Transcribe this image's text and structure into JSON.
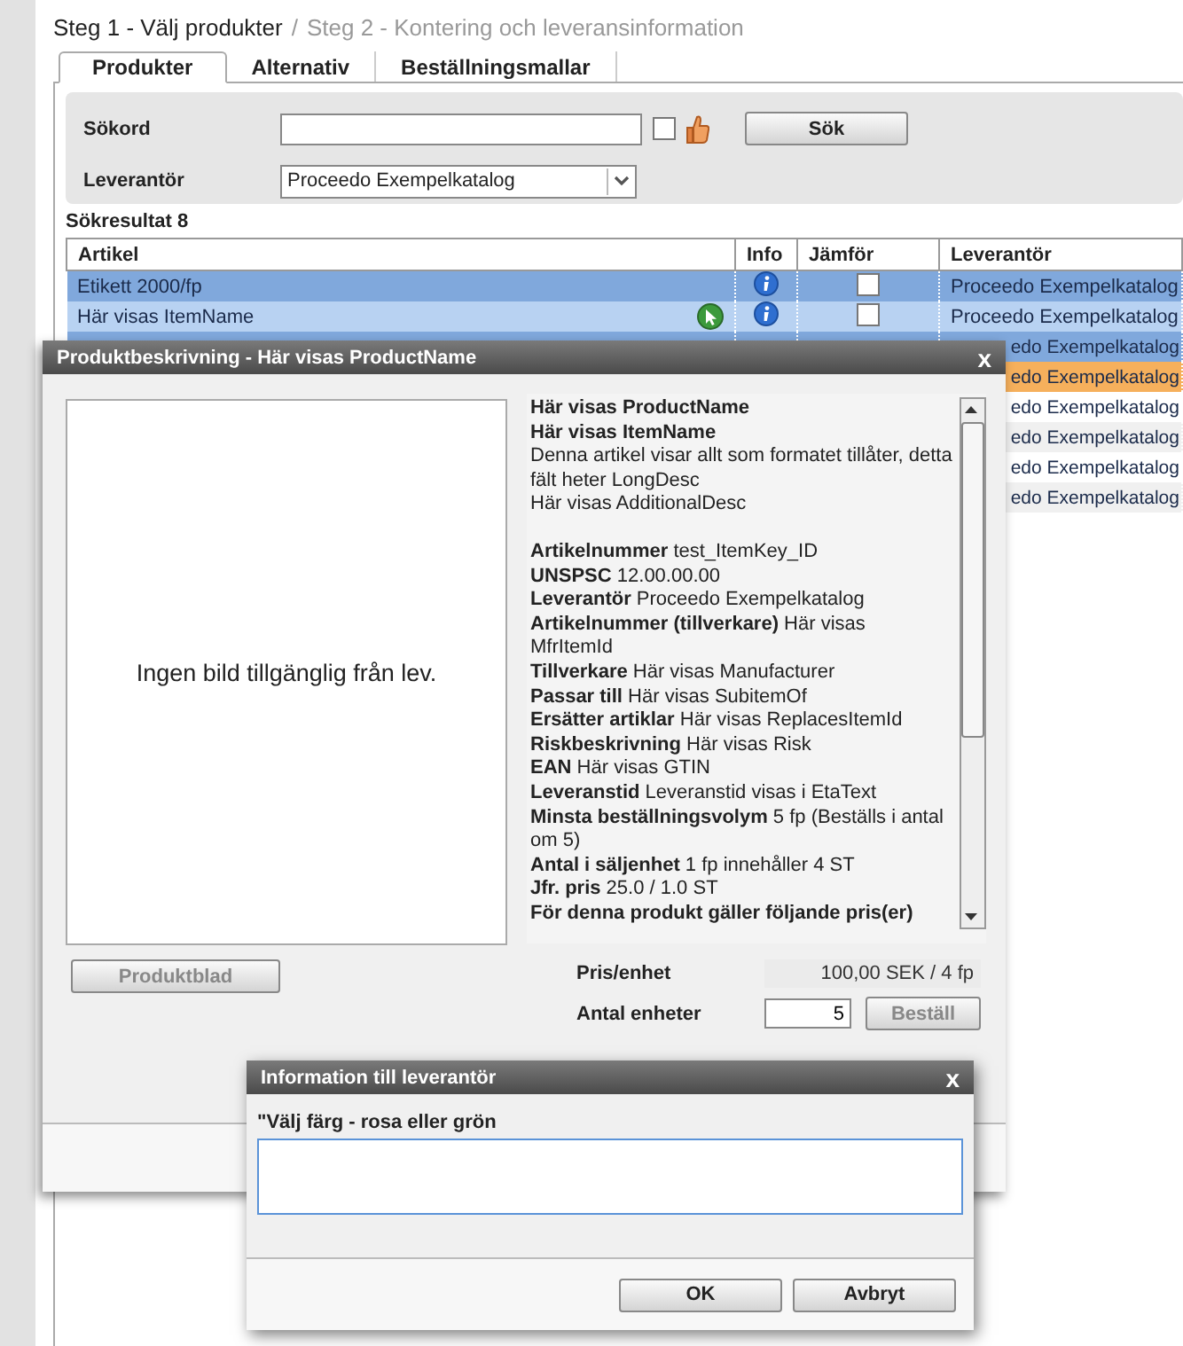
{
  "breadcrumb": {
    "separator": "/",
    "steps": [
      {
        "label": "Steg 1 - Välj produkter",
        "selected": true
      },
      {
        "label": "Steg 2 - Kontering och leveransinformation",
        "selected": false
      }
    ]
  },
  "tabs": [
    {
      "label": "Produkter",
      "selected": true
    },
    {
      "label": "Alternativ",
      "selected": false
    },
    {
      "label": "Beställningsmallar",
      "selected": false
    }
  ],
  "search": {
    "keyword_label": "Sökord",
    "checkbox_checked": false,
    "button": "Sök",
    "supplier_label": "Leverantör",
    "supplier_value": "Proceedo Exempelkatalog"
  },
  "results_label": "Sökresultat 8",
  "table": {
    "columns": [
      "Artikel",
      "Info",
      "Jämför",
      "Leverantör"
    ],
    "rows": [
      {
        "article": "Etikett 2000/fp",
        "status_icon": false,
        "compare": false,
        "supplier": "Proceedo Exempelkatalog",
        "color": "#80a8dc"
      },
      {
        "article": "Här visas ItemName",
        "status_icon": true,
        "compare": false,
        "supplier": "Proceedo Exempelkatalog",
        "color": "#b8d2f2"
      },
      {
        "supplier": "edo Exempelkatalog",
        "color": "#80a8dc"
      },
      {
        "supplier": "edo Exempelkatalog",
        "color": "#f6b05c"
      },
      {
        "supplier": "edo Exempelkatalog",
        "color": "#ffffff"
      },
      {
        "supplier": "edo Exempelkatalog",
        "color": "#f0f0f0"
      },
      {
        "supplier": "edo Exempelkatalog",
        "color": "#ffffff"
      },
      {
        "supplier": "edo Exempelkatalog",
        "color": "#f0f0f0"
      }
    ]
  },
  "product_dialog": {
    "title": "Produktbeskrivning - Här visas ProductName",
    "close": "x",
    "no_image": "Ingen bild tillgänglig från lev.",
    "heading_lines": [
      "Här visas ProductName",
      "Här visas ItemName"
    ],
    "text_lines": [
      "Denna artikel visar allt som formatet tillåter, detta fält heter LongDesc",
      "Här visas AdditionalDesc"
    ],
    "properties": [
      {
        "label": "Artikelnummer",
        "value": "test_ItemKey_ID"
      },
      {
        "label": "UNSPSC",
        "value": "12.00.00.00"
      },
      {
        "label": "Leverantör",
        "value": "Proceedo Exempelkatalog"
      },
      {
        "label": "Artikelnummer (tillverkare)",
        "value": "Här visas MfrItemId"
      },
      {
        "label": "Tillverkare",
        "value": "Här visas Manufacturer"
      },
      {
        "label": "Passar till",
        "value": "Här visas SubitemOf"
      },
      {
        "label": "Ersätter artiklar",
        "value": "Här visas ReplacesItemId"
      },
      {
        "label": "Riskbeskrivning",
        "value": "Här visas Risk"
      },
      {
        "label": "EAN",
        "value": "Här visas GTIN"
      },
      {
        "label": "Leveranstid",
        "value": "Leveranstid visas i EtaText"
      },
      {
        "label": "Minsta beställningsvolym",
        "value": "5 fp (Beställs i antal om 5)"
      },
      {
        "label": "Antal i säljenhet",
        "value": "1 fp innehåller 4 ST"
      },
      {
        "label": "Jfr. pris",
        "value": "25.0  / 1.0 ST"
      },
      {
        "label": "För denna produkt gäller följande pris(er)"
      }
    ],
    "sheet_button": {
      "label": "Produktblad",
      "disabled": true
    },
    "price_label": "Pris/enhet",
    "price_value": "100,00 SEK  / 4 fp",
    "quantity_label": "Antal enheter",
    "quantity_value": "5",
    "order_button": {
      "label": "Beställ",
      "disabled": true
    }
  },
  "info_dialog": {
    "title": "Information till leverantör",
    "close": "x",
    "prompt": "\"Välj färg - rosa eller grön",
    "buttons": [
      "OK",
      "Avbryt"
    ]
  }
}
